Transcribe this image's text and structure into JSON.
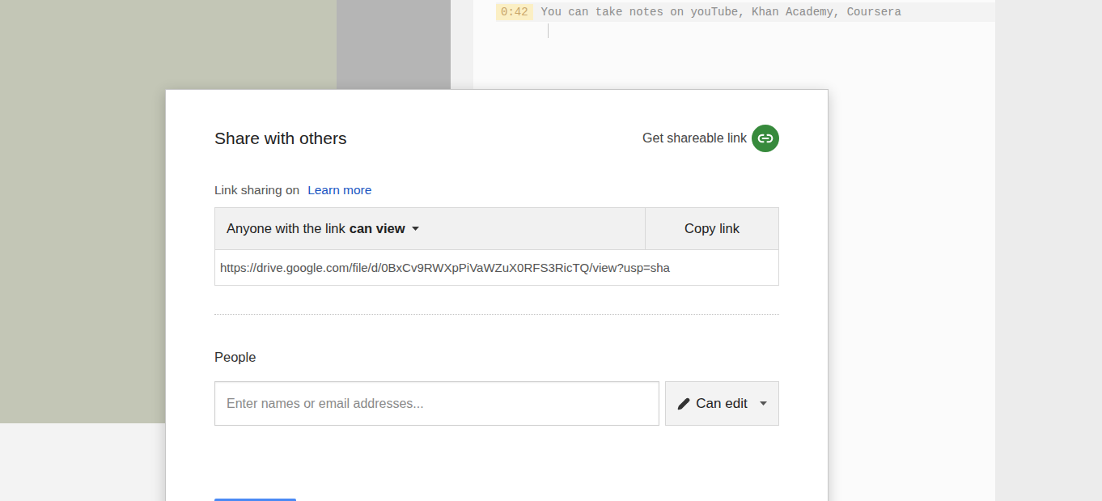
{
  "notes": {
    "lines": [
      {
        "time": "0:42",
        "text": "You can take notes on youTube, Khan Academy, Coursera"
      }
    ]
  },
  "dialog": {
    "title": "Share with others",
    "shareable_link": "Get shareable link",
    "link_sharing": {
      "status": "Link sharing on",
      "learn_more": "Learn more"
    },
    "access": {
      "prefix": "Anyone with the link",
      "permission": "can view"
    },
    "copy_button": "Copy link",
    "url": "https://drive.google.com/file/d/0BxCv9RWXpPiVaWZuX0RFS3RicTQ/view?usp=sha",
    "people": {
      "label": "People",
      "placeholder": "Enter names or email addresses...",
      "role": "Can edit"
    }
  }
}
